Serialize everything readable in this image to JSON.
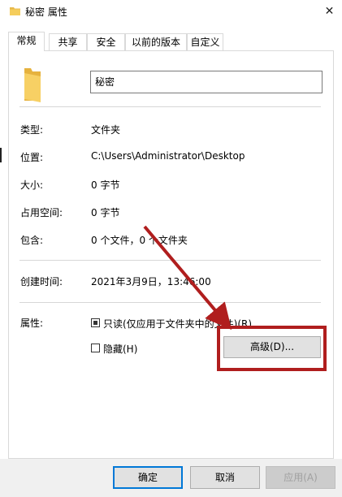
{
  "window": {
    "title": "秘密 属性",
    "close_glyph": "✕"
  },
  "tabs": [
    {
      "label": "常规",
      "active": true
    },
    {
      "label": "共享"
    },
    {
      "label": "安全"
    },
    {
      "label": "以前的版本"
    },
    {
      "label": "自定义"
    }
  ],
  "general": {
    "name_value": "秘密",
    "type_label": "类型:",
    "type_value": "文件夹",
    "location_label": "位置:",
    "location_value": "C:\\Users\\Administrator\\Desktop",
    "size_label": "大小:",
    "size_value": "0 字节",
    "disk_size_label": "占用空间:",
    "disk_size_value": "0 字节",
    "contains_label": "包含:",
    "contains_value": "0 个文件，0 个文件夹",
    "created_label": "创建时间:",
    "created_value": "2021年3月9日，13:46:00",
    "attributes_label": "属性:",
    "readonly_label": "只读(仅应用于文件夹中的文件)(R)",
    "readonly_checked": "indeterminate",
    "hidden_label": "隐藏(H)",
    "hidden_checked": false,
    "advanced_button": "高级(D)..."
  },
  "footer": {
    "ok": "确定",
    "cancel": "取消",
    "apply": "应用(A)"
  },
  "annotation": {
    "color": "#b01e1e"
  }
}
